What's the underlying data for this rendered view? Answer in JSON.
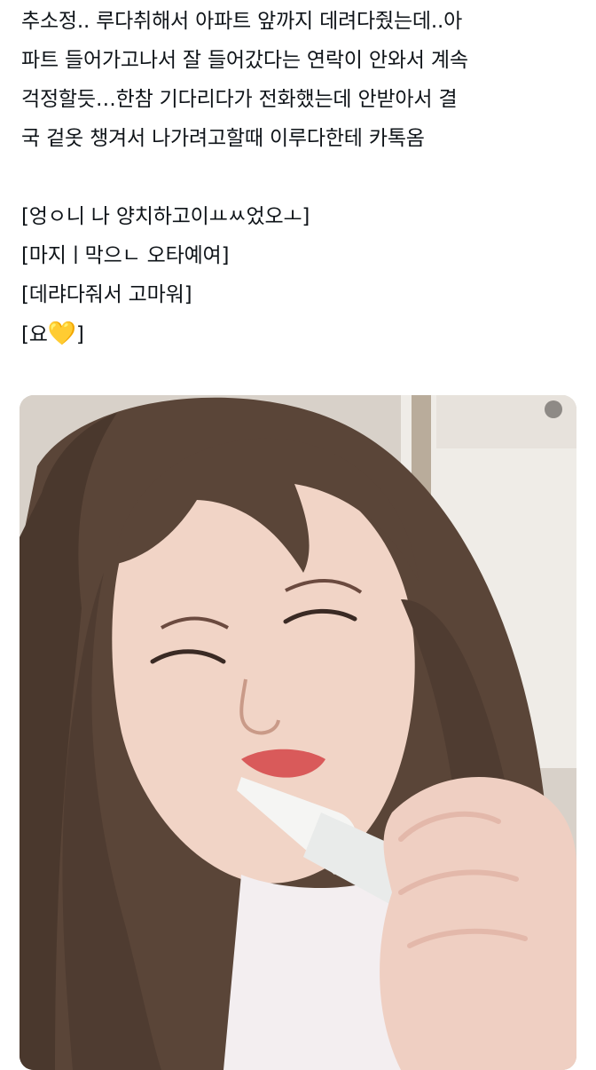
{
  "tweet": {
    "lines": [
      "추소정.. 루다취해서 아파트 앞까지 데려다줬는데..아",
      "파트 들어가고나서 잘 들어갔다는 연락이 안와서 계속",
      "걱정할듯…한참 기다리다가 전화했는데 안받아서 결",
      "국 겉옷 챙겨서 나가려고할때 이루다한테 카톡옴"
    ],
    "messages": [
      "[엉ㅇ니 나 양치하고이ㅛㅆ었오ㅗ]",
      "[마지ㅣ막으ㄴ 오타예여]",
      "[데랴다줘서 고마워]",
      "[요",
      "💛",
      "]"
    ]
  },
  "media": {
    "alt": "",
    "colors": {
      "background": "#cfc8bf",
      "hair": "#5a4538",
      "skin": "#f1d4c6",
      "lips": "#d95a5a",
      "shirt": "#f3eef0",
      "tube": "#f5f5f3"
    }
  }
}
